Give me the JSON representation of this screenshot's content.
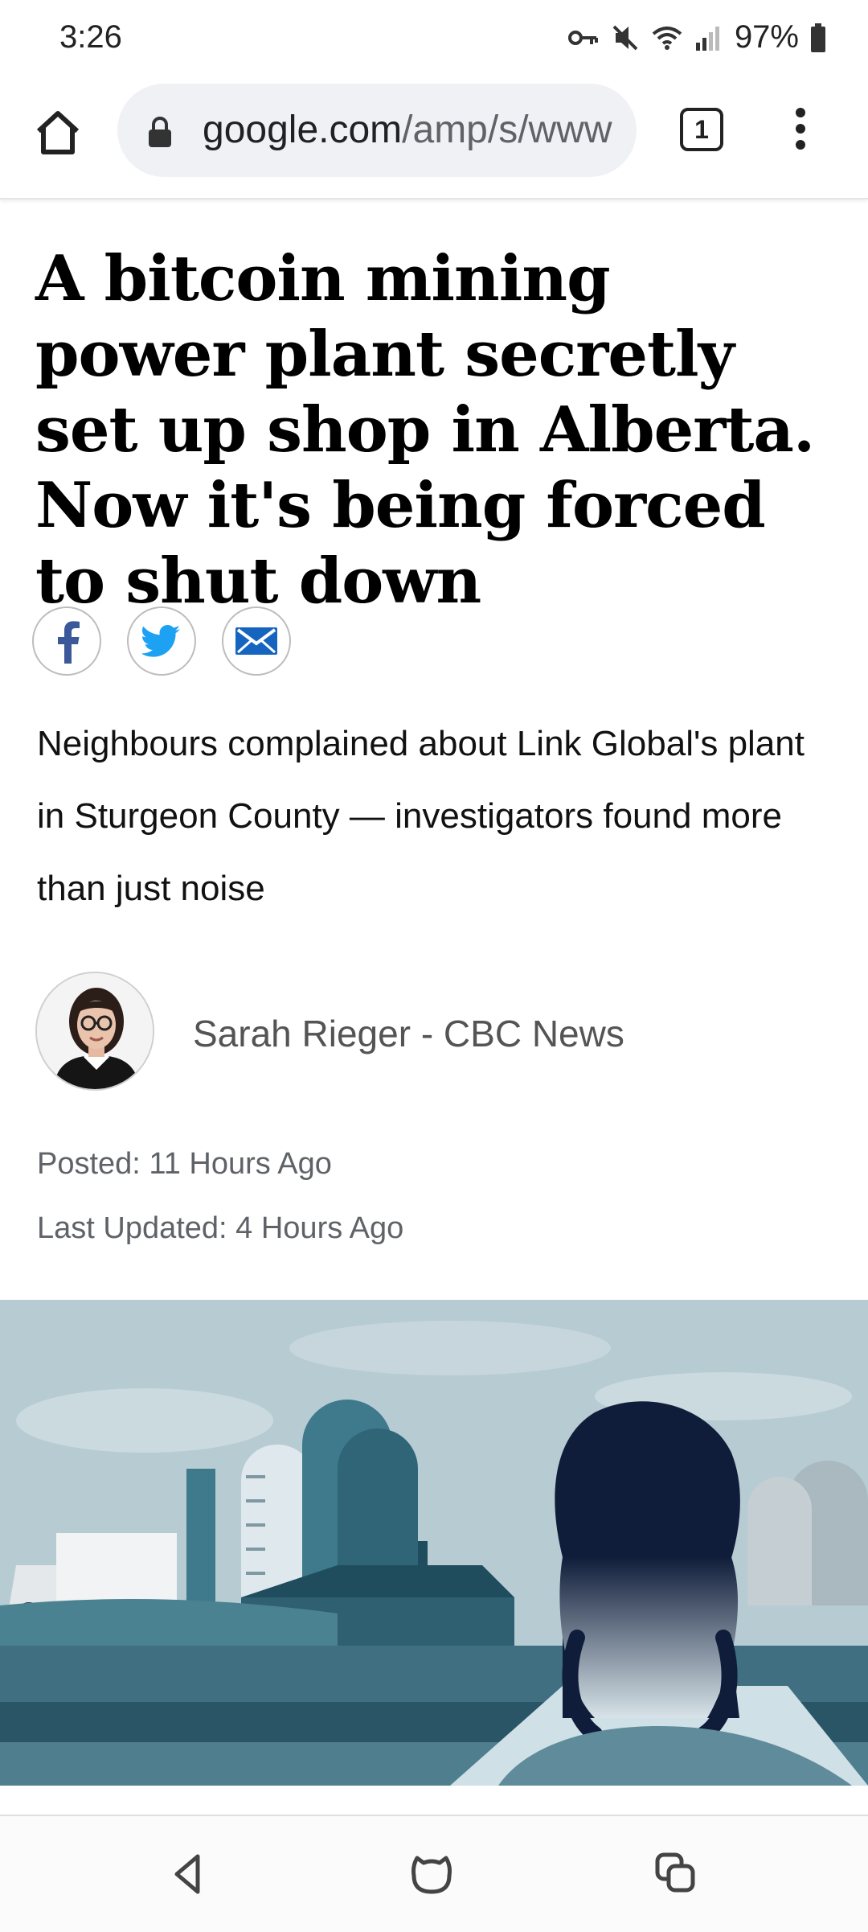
{
  "status": {
    "time": "3:26",
    "battery": "97%",
    "icons": [
      "key-icon",
      "mute-icon",
      "wifi-icon",
      "signal-icon",
      "battery-icon"
    ]
  },
  "browser": {
    "url_domain": "google.com",
    "url_path": "/amp/s/www",
    "tab_count": "1",
    "icons": [
      "home-icon",
      "lock-icon",
      "tab-switcher-icon",
      "more-vert-icon"
    ]
  },
  "article": {
    "headline": "A bitcoin mining power plant secretly set up shop in Alberta. Now it's being forced to shut down",
    "share": [
      "facebook-icon",
      "twitter-icon",
      "email-icon"
    ],
    "dek": "Neighbours complained about Link Global's plant in Sturgeon County — investigators found more than just noise",
    "byline": "Sarah Rieger - CBC News",
    "posted": "Posted: 11 Hours Ago",
    "updated": "Last Updated: 4 Hours Ago"
  },
  "nav": {
    "icons": [
      "back-icon",
      "home-nav-icon",
      "recents-icon"
    ]
  },
  "colors": {
    "facebook": "#3b5998",
    "twitter": "#1da1f2",
    "email": "#1565c0",
    "illustration_sky": "#b7cbd3",
    "illustration_teal": "#3e7a8c"
  }
}
